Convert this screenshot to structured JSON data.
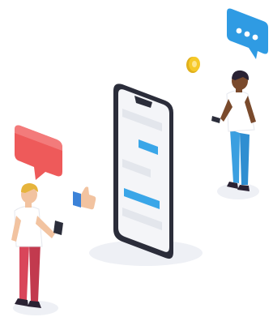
{
  "scene": {
    "description_kind": "isometric-messaging-illustration",
    "colors": {
      "background": "#ffffff",
      "phone_frame": "#2b2d3a",
      "phone_screen": "#f4f5f8",
      "message_gray": "#e3e6ec",
      "message_blue": "#3aa6e8",
      "chat_bubble_blue": "#2f9be3",
      "chat_bubble_red": "#ee5a5a",
      "coin_yellow": "#f6c928",
      "shirt_white": "#ffffff",
      "pants_red": "#d9465a",
      "pants_blue": "#3b9fe0",
      "skin_light": "#f2c3a0",
      "skin_dark": "#7a4a2c",
      "hair_blonde": "#e6b43c",
      "hair_dark": "#2a2233",
      "thumbs_up_blue": "#3b82d8"
    },
    "icons": [
      "chat-bubble-typing-icon",
      "chat-bubble-icon",
      "coin-icon",
      "thumbs-up-icon",
      "smartphone-icon"
    ]
  }
}
